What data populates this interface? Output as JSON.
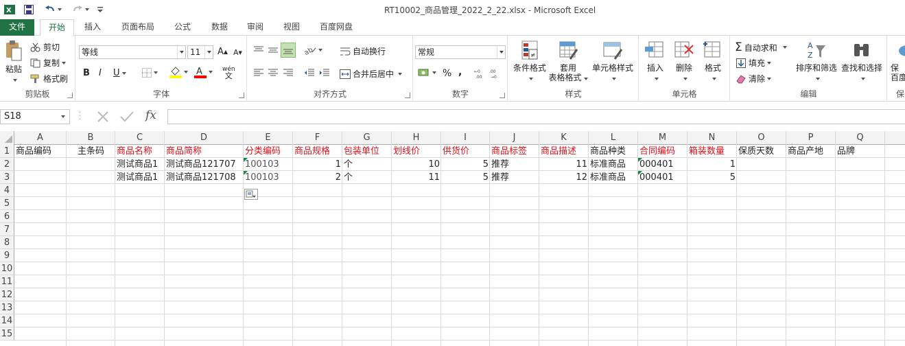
{
  "window": {
    "title": "RT10002_商品管理_2022_2_22.xlsx - Microsoft Excel"
  },
  "quick_access": {
    "excel_icon": "excel-logo-icon",
    "save_icon": "save-icon",
    "undo_icon": "undo-icon",
    "redo_icon": "redo-icon",
    "customize_icon": "customize-icon"
  },
  "tabs": [
    "文件",
    "开始",
    "插入",
    "页面布局",
    "公式",
    "数据",
    "审阅",
    "视图",
    "百度网盘"
  ],
  "ribbon": {
    "clipboard": {
      "paste": "粘贴",
      "cut": "剪切",
      "copy": "复制",
      "format_painter": "格式刷",
      "label": "剪贴板"
    },
    "font": {
      "name": "等线",
      "size": "11",
      "label": "字体",
      "bold": "B",
      "italic": "I",
      "underline": "U",
      "grow": "A",
      "shrink": "A",
      "phonetic": "wén"
    },
    "alignment": {
      "wrap": "自动换行",
      "merge": "合并后居中",
      "label": "对齐方式"
    },
    "number": {
      "format": "常规",
      "percent": "%",
      "comma": ",",
      "label": "数字"
    },
    "styles": {
      "conditional": "条件格式",
      "table1": "套用",
      "table2": "表格格式",
      "cell_styles": "单元格样式",
      "label": "样式"
    },
    "cells": {
      "insert": "插入",
      "delete": "删除",
      "format": "格式",
      "label": "单元格"
    },
    "editing": {
      "autosum": "自动求和",
      "fill": "填充",
      "clear": "清除",
      "sort": "排序和筛选",
      "find": "查找和选择",
      "label": "编辑"
    },
    "extra": {
      "save1": "保",
      "save2": "百度",
      "label": "保"
    },
    "colors": {
      "highlight": "#ffff00",
      "font_color": "#ff0000"
    }
  },
  "formula_bar": {
    "name_box": "S18",
    "fx": "fx",
    "value": ""
  },
  "sheet": {
    "columns": [
      "A",
      "B",
      "C",
      "D",
      "E",
      "F",
      "G",
      "H",
      "I",
      "J",
      "K",
      "L",
      "M",
      "N",
      "O",
      "P",
      "Q"
    ],
    "rows": [
      "1",
      "2",
      "3",
      "4",
      "5",
      "6",
      "7",
      "8",
      "9",
      "10",
      "11",
      "12",
      "13",
      "14",
      "15"
    ],
    "header_row": [
      "商品编码",
      "主条码",
      "商品名称",
      "商品简称",
      "分类编码",
      "商品规格",
      "包装单位",
      "划线价",
      "供货价",
      "商品标签",
      "商品描述",
      "商品种类",
      "合同编码",
      "箱装数量",
      "保质天数",
      "商品产地",
      "品牌"
    ],
    "header_colors": [
      "#262626",
      "#262626",
      "#e0101a",
      "#e0101a",
      "#e0101a",
      "#e0101a",
      "#e0101a",
      "#e0101a",
      "#e0101a",
      "#e0101a",
      "#e0101a",
      "#262626",
      "#e0101a",
      "#e0101a",
      "#262626",
      "#262626",
      "#262626"
    ],
    "data_rows": [
      [
        "",
        "",
        "测试商品1",
        "测试商品121707",
        "100103",
        "1",
        "个",
        "10",
        "5",
        "推荐",
        "11",
        "标准商品",
        "000401",
        "1",
        "",
        "",
        ""
      ],
      [
        "",
        "",
        "测试商品1",
        "测试商品121708",
        "100103",
        "2",
        "个",
        "11",
        "5",
        "推荐",
        "12",
        "标准商品",
        "000401",
        "5",
        "",
        "",
        ""
      ]
    ]
  }
}
